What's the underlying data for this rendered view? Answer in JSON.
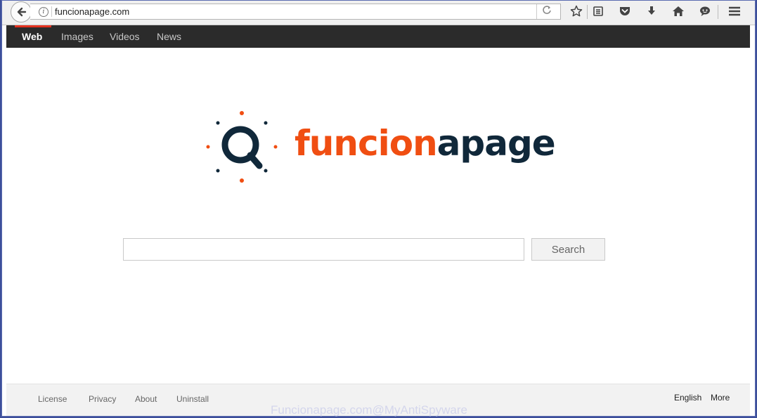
{
  "browser": {
    "url": "funcionapage.com",
    "icons": {
      "back": "back-arrow-icon",
      "info": "info-icon",
      "reload": "reload-icon",
      "bookmark": "star-icon",
      "reading_list": "reading-list-icon",
      "pocket": "pocket-icon",
      "download": "download-icon",
      "home": "home-icon",
      "chat": "chat-icon",
      "menu": "hamburger-menu-icon"
    }
  },
  "nav": {
    "items": [
      "Web",
      "Images",
      "Videos",
      "News"
    ],
    "active": "Web",
    "accent": "#e4311e"
  },
  "logo": {
    "part1": "funcion",
    "part2": "apage",
    "color1": "#f04e12",
    "color2": "#10283a"
  },
  "search": {
    "value": "",
    "button_label": "Search"
  },
  "footer": {
    "links": [
      "License",
      "Privacy",
      "About",
      "Uninstall"
    ],
    "language": "English",
    "more": "More"
  },
  "watermark": "Funcionapage.com@MyAntiSpyware"
}
